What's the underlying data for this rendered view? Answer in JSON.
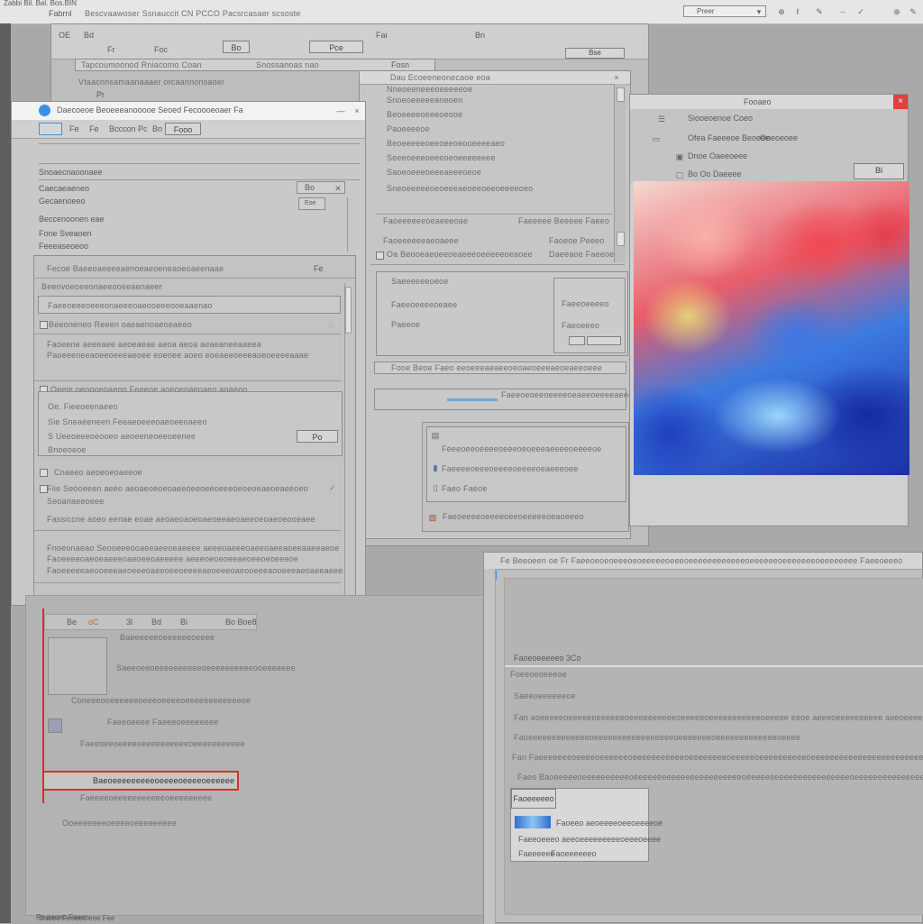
{
  "topbar": {
    "app_title": "Zabbi Bil. Bal. Bos.BIN",
    "file_label": "Fabrnl",
    "path_text": "Bescvaawoser Ssnauccit CN PCCO Pacsrcasaer scsoste",
    "view_select": "Preer",
    "tool_icons": [
      "⊕",
      "ℓ",
      "⌣",
      "⊥",
      "✓",
      "⊕",
      "✎"
    ]
  },
  "back_window": {
    "toolbar_items": [
      "OE",
      "Bd",
      "Fr",
      "Foc",
      "Bo",
      "Pce",
      "Fai",
      "Bn",
      "Bse"
    ],
    "address_text": "Tapcoumoonod Rniacomo Coan",
    "address_text2": "Snossanoas nao",
    "address_right": "Fosn",
    "line1": "Vtaacnnsamaanaaaer orcaannonsaoer",
    "line2": "Pr"
  },
  "settings_dialog": {
    "title": "Daecoeoe Beoeeeanooooe Seoed Fecoooeoaer Fa",
    "tabs": [
      "Fe",
      "Fe",
      "Bcccon",
      "Pc",
      "Bn",
      "Fooo"
    ],
    "heading": "Snoaecnaoonaee",
    "rows": [
      {
        "label": "Caecaeaeneo",
        "value": "Bo"
      },
      {
        "label": "Gecaenoeeo",
        "value": "Eoe"
      },
      {
        "label": "Beccenoonen eae",
        "value": ""
      },
      {
        "label": "Fone Sveaoen",
        "value": ""
      },
      {
        "label": "Feeeaseoeoo",
        "value": ""
      }
    ],
    "subpanel_title": "Fecoe Baeeoaeeeeaenoeaeoeneaoeoaeenaae",
    "subpanel_tag": "Fe",
    "subpanel_row1": "Beenvoeoeeonaeeooeeaenaeer",
    "subpanel_row2": "Faeeoeeeoeeeonaeeeoaeooeeeooeaaenao",
    "subpanel_row3": "Beeoneneo Reeen oaeaenoaeoeaeeo",
    "section_text1": "Faoeene aeeeaee aeoeaeae aeoa aeoa aeaeaneeaaeea",
    "section_text2": "Paoeeeneeaoeeoeeeaeoee eoeoee aoeo eoeaeeoeeeaoeoeeeeaaae",
    "group_title": "Oeeie oeoooeoaeoo Feeeoe aoeoeoaeoaeo aoaeoo",
    "options": [
      {
        "label": "Oe. Fieeoeenaeeo",
        "value": ""
      },
      {
        "label": "Sie Sneaeeneen Feeaeoeeeoaeoeeoaeeo",
        "value": ""
      },
      {
        "label": "S Ueeoeeeoeooeo aeoeeneoeeoeenee",
        "value": "Po"
      },
      {
        "label": "Bnoeoeoe",
        "value": ""
      }
    ],
    "options2": [
      {
        "label": "Cnaeeo aeoeoeoaeeoe",
        "value": ""
      },
      {
        "label": "Fiie Seooeeen aeeo aeoaeoeoeoaeeoeeoeeoeeeoeoeoeaeoeaeeoeo",
        "value": ""
      },
      {
        "label": "Seoanaeeoeee",
        "value": ""
      },
      {
        "label": "Fassiccne aoeo eenae eoae aeoaeoaoeoaeoeeaeoaeeoeoaeoeooeaee",
        "value": ""
      }
    ],
    "footer1": "Fnoeonaeao Seooeeeooaeeaeeoeaeeee aeeeoaeeeoaeeoaeeaoeeaaeeaeoe",
    "footer2": "Faoeeeeoaeoeaeeeoaeoeeoaeeeee aeeeoeoeoeeaeoeeoeoeeeoe",
    "footer3": "Faoeeeeeaeooeeeaeoeeeoaeeoeeoeeeeaeoeeeoaeooeeeaooeeeaeoaeeaeee"
  },
  "list_window": {
    "header": "Dau Ecoeeneonecaoe eoa",
    "items": [
      "Nneoeeneeeoeeeeeoe",
      "Snoeoeeeeeaneoen",
      "Beoeeeeoeeeoeooe",
      "Paoeeeeoe",
      "Beoeeeeeoeeoeeoeooeeeeaeo",
      "Seeeoeeeoeeeoeoeeeeeeee",
      "Saoeoeeeoeeeaeeeoeoe",
      "Sneoeeeeeoeoeeeaeoeeoeeoeeeeoeo"
    ],
    "row_a_left": "Faoeeeeeeoeaeeeoae",
    "row_a_right": "Faeeeee Beeeee Faeeo",
    "row_b_left": "Faoeeeeeeaeoaeee",
    "row_b_right": "Faoeoe Peeeo",
    "row_c_left": "Oa Beooeaeoeeoeaeeeoeeeeeoeaoee",
    "row_c_right": "Daeeaoe Faeeoe",
    "sub_rows": [
      "Saeeeeeeoeoe",
      "Faeeoeeeeoeaee",
      "Paeeoe"
    ],
    "sub_right": [
      "Faeeoeeeeo",
      "Faeoeeeo"
    ],
    "bottom_line": "Fooe Beoe Faeo eeoeeeaeaeeoeoaeoeeeaeoeaeeoeee",
    "bottom2": "Faeeoeoeeoeeeeoeaeeoeeeeaeeoeeeoeee"
  },
  "small_panel": {
    "rows": [
      "Feeeoeeoeeeeoeeeoeoeeeaeeeeoeeeeoe",
      "Faeeeeoeeeoeeeeoeeeeoeaeeeoee",
      "Faeo Faeoe"
    ],
    "last": "Faeoeeeeoeeeeoeeoeeeeeoeaoeeeo"
  },
  "image_viewer": {
    "title": "Fooaeo",
    "menu": [
      {
        "icon": "☰",
        "label": "Siooeoenoe Coeo"
      },
      {
        "icon": "▭",
        "label": "Ofea Faeeeoe Beoeee",
        "extra": "Oneoeoee"
      },
      {
        "icon": "▣",
        "label": "Dnoe Oaeeoeee"
      },
      {
        "icon": "▢",
        "label": "Bo Oo Daeeee"
      }
    ],
    "button": "Bl"
  },
  "lower_left": {
    "toolbar": [
      "Be",
      "oC",
      "3l",
      "Bd",
      "Bi",
      "Bo Boe8"
    ],
    "rows": [
      "Baeeeeeeoeeeeeeoeeee",
      "Saeeoeeoeeeeeeeeeeoeeeeeeeeeeooeeeeeee",
      "Coneeeooeeeeeeoeeeoeeeeoeeeeeeeeeeeeoe",
      "Faeeoeeee Faeeeoeeeeeeee",
      "Faeeoeeoeeeeoeeeeeeeeeeoeeeeeeeeeee"
    ],
    "highlight": "Baeoeeeeeeeeeoeeeeoeeeeoeeeeee",
    "below": "Faeeeeoeeeeeeeeeeeoeeeeeeeee",
    "bottom": "Ooeeeeeeeoeeeeoeeeeeeeee",
    "status": "Daoeo Feeeeo eee Fee"
  },
  "right_window": {
    "title": "Fe Beeoeen oe  Fr  Faeeoeoeoeeeoeoeeeeeoeeeoeeeeeeeeeeeeoeeeeeeoeeeeeeeoeeeeeeee Faeeoeeeo",
    "section_label": "Faoeoeeeeeo 3Co",
    "subsection": "Foeeoeoeeeoe",
    "subsection2": "Saeeoeeeeeeoe",
    "lines": [
      "Fan aoeeeeeoeeeeeoeeeeeeoeeeeeeeeeeoeeeeeoeeeeeeeeeeeoeeeee eeoe aeeeoeeeeeeeeee aeeoeeeeeeeoeee",
      "Faoeeeeeeeeeeeeeoeeeeeeeeeeeeeeeeeoeeeeeeeoeeeeeeeeeeeeeoeeee",
      "Fan Faeeeeeeeoeeeeoeeeeeeoeeeeeeeeeeeoeeeeeeeeoeeeeeoeeeeeeeeeeoeeeeeeeeeeeeeeeeeeeeeeeeeeeee",
      "Faeo Baoeeeeeoeeeeeeeeeeoeeeeeeeeeeeeeeeeeeeeeeeoeeeeeeeeeeeeeeeeeeeeeeoeeeeeeeeeeeeeeeeeeeee"
    ],
    "popup_tab": "Faoeeeeeo",
    "popup_item1": "Faoeeo aeoeeeeoeeoeeeeoe",
    "popup_item2_a": "Faeeoeeeo aeeoeeeeeeeeeoeeeoeeee",
    "popup_item3": "Faeeeeeo",
    "popup_item3b": "Faoeeeeeeo"
  },
  "bottom_status": "Fe aeoeo Faeeo",
  "colors": {
    "accent_blue": "#3b8fe6",
    "highlight_red": "#d33030",
    "close_red": "#e04040"
  }
}
